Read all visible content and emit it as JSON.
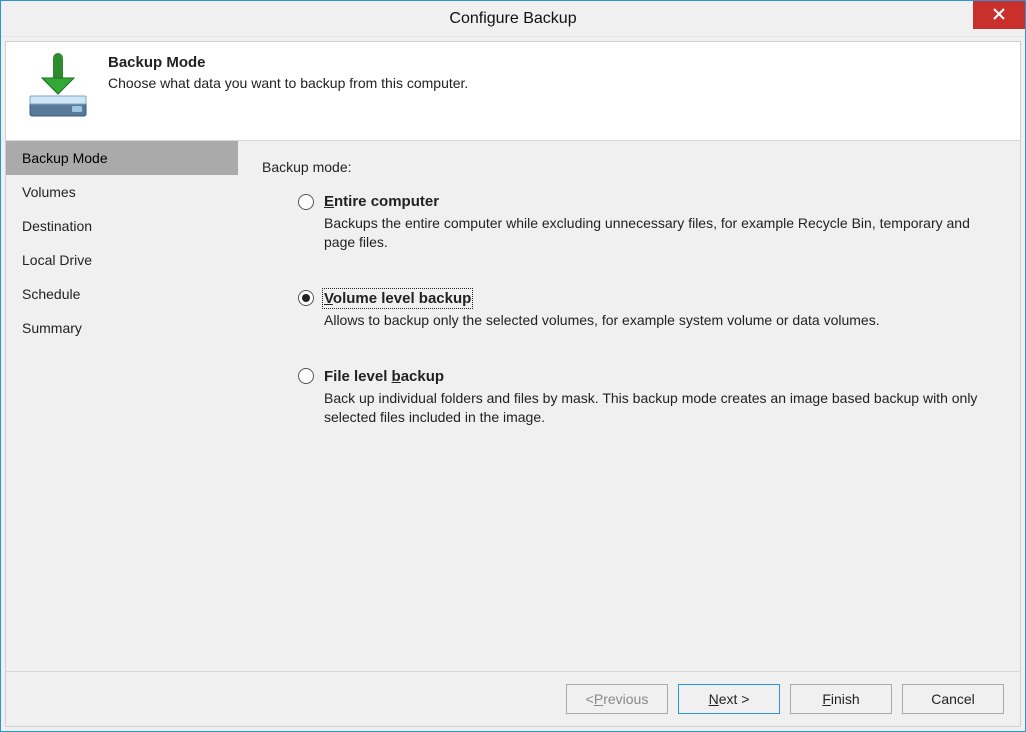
{
  "window": {
    "title": "Configure Backup"
  },
  "header": {
    "title": "Backup Mode",
    "description": "Choose what data you want to backup from this computer."
  },
  "sidebar": {
    "items": [
      {
        "label": "Backup Mode",
        "active": true
      },
      {
        "label": "Volumes",
        "active": false
      },
      {
        "label": "Destination",
        "active": false
      },
      {
        "label": "Local Drive",
        "active": false
      },
      {
        "label": "Schedule",
        "active": false
      },
      {
        "label": "Summary",
        "active": false
      }
    ]
  },
  "content": {
    "label": "Backup mode:",
    "options": [
      {
        "title_pre": "",
        "title_u": "E",
        "title_post": "ntire computer",
        "desc": "Backups the entire computer while excluding unnecessary files, for example Recycle Bin, temporary and page files.",
        "checked": false,
        "focused": false
      },
      {
        "title_pre": "",
        "title_u": "V",
        "title_post": "olume level backup",
        "desc": "Allows to backup only the selected volumes, for example system volume or data volumes.",
        "checked": true,
        "focused": true
      },
      {
        "title_pre": "File level ",
        "title_u": "b",
        "title_post": "ackup",
        "desc": "Back up individual folders and files by mask. This backup mode creates an image based backup with only selected files included in the image.",
        "checked": false,
        "focused": false
      }
    ]
  },
  "footer": {
    "previous": {
      "pre": "< ",
      "u": "P",
      "post": "revious",
      "disabled": true
    },
    "next": {
      "pre": "",
      "u": "N",
      "post": "ext >",
      "default": true
    },
    "finish": {
      "pre": "",
      "u": "F",
      "post": "inish"
    },
    "cancel": {
      "label": "Cancel"
    }
  }
}
